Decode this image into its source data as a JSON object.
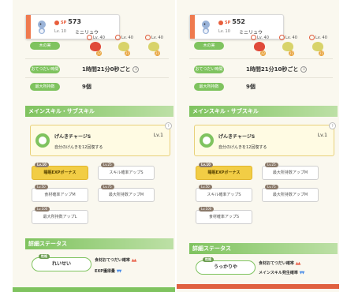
{
  "panels": [
    {
      "header": {
        "sp_label": "SP",
        "sp_value": "573",
        "level": "Lv. 10",
        "name": "ミニリュウ"
      },
      "berry_levels": [
        "Lv. 40",
        "Lv. 40",
        "Lv. 40"
      ],
      "berry_counts": [
        "22",
        "22",
        "22"
      ],
      "labels": {
        "berry": "木の実",
        "help": "おてつだい時間",
        "max": "最大所持数"
      },
      "help_time": "1時間21分0秒ごと",
      "max_count": "9個",
      "section_skill": "メインスキル・サブスキル",
      "skill": {
        "name": "げんきチャージS",
        "level": "Lv.1",
        "desc": "自分のげんきを12回復する"
      },
      "subskills": [
        {
          "tag": "Lv.10",
          "label": "睡眠EXPボーナス",
          "gold": true
        },
        {
          "tag": "Lv.25",
          "label": "スキル確率アップS",
          "gold": false
        },
        {
          "tag": "Lv.50",
          "label": "食材確率アップM",
          "gold": false
        },
        {
          "tag": "Lv.75",
          "label": "最大所持数アップM",
          "gold": false
        },
        {
          "tag": "Lv.100",
          "label": "最大所持数アップL",
          "gold": false
        }
      ],
      "section_detail": "詳細ステータス",
      "nature": {
        "tag": "性格",
        "name": "れいせい"
      },
      "effects": [
        {
          "label": "食材おてつだい確率",
          "arrows": "▲▲",
          "dir": "up"
        },
        {
          "label": "EXP獲得量",
          "arrows": "▼▼",
          "dir": "down"
        }
      ]
    },
    {
      "header": {
        "sp_label": "SP",
        "sp_value": "552",
        "level": "Lv. 10",
        "name": "ミニリュウ"
      },
      "berry_levels": [
        "Lv. 40",
        "Lv. 40",
        "Lv. 40"
      ],
      "berry_counts": [
        "22",
        "22",
        "22"
      ],
      "labels": {
        "berry": "木の実",
        "help": "おてつだい時間",
        "max": "最大所持数"
      },
      "help_time": "1時間21分10秒ごと",
      "max_count": "9個",
      "section_skill": "メインスキル・サブスキル",
      "skill": {
        "name": "げんきチャージS",
        "level": "Lv.1",
        "desc": "自分のげんきを12回復する"
      },
      "subskills": [
        {
          "tag": "Lv.10",
          "label": "睡眠EXPボーナス",
          "gold": true
        },
        {
          "tag": "Lv.25",
          "label": "最大所持数アップM",
          "gold": false
        },
        {
          "tag": "Lv.50",
          "label": "スキル確率アップS",
          "gold": false
        },
        {
          "tag": "Lv.75",
          "label": "最大所持数アップM",
          "gold": false
        },
        {
          "tag": "Lv.100",
          "label": "食材確率アップS",
          "gold": false
        }
      ],
      "section_detail": "詳細ステータス",
      "nature": {
        "tag": "性格",
        "name": "うっかりや"
      },
      "effects": [
        {
          "label": "食材おてつだい確率",
          "arrows": "▲▲",
          "dir": "up"
        },
        {
          "label": "メインスキル発生確率",
          "arrows": "▼▼",
          "dir": "down"
        }
      ]
    }
  ],
  "colors": {
    "accent_green": "#7fc35f",
    "gold": "#f2cd45",
    "header_accent": "#ef7a4f",
    "up": "#e8604a",
    "down": "#4a8de8"
  }
}
